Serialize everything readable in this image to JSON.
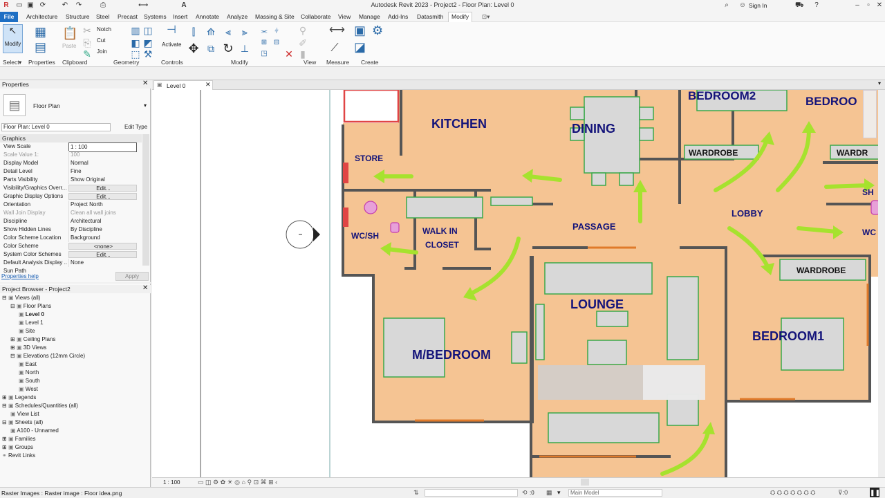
{
  "app": {
    "title": "Autodesk Revit 2023 - Project2 - Floor Plan: Level 0",
    "sign_in": "Sign In"
  },
  "menu": {
    "tabs": [
      "File",
      "Architecture",
      "Structure",
      "Steel",
      "Precast",
      "Systems",
      "Insert",
      "Annotate",
      "Analyze",
      "Massing & Site",
      "Collaborate",
      "View",
      "Manage",
      "Add-Ins",
      "Datasmith",
      "Modify"
    ],
    "active": "Modify"
  },
  "ribbon": {
    "panels": [
      "Select",
      "Properties",
      "Clipboard",
      "Geometry",
      "Controls",
      "Modify",
      "View",
      "Measure",
      "Create"
    ],
    "modify_label": "Modify",
    "paste_label": "Paste",
    "activate_label": "Activate",
    "notch": "Notch",
    "cut": "Cut",
    "join": "Join"
  },
  "properties": {
    "title": "Properties",
    "type_name": "Floor Plan",
    "instance_selector": "Floor Plan: Level 0",
    "edit_type": "Edit Type",
    "group": "Graphics",
    "rows": [
      {
        "k": "View Scale",
        "v": "1 : 100"
      },
      {
        "k": "Scale Value    1:",
        "v": "100"
      },
      {
        "k": "Display Model",
        "v": "Normal"
      },
      {
        "k": "Detail Level",
        "v": "Fine"
      },
      {
        "k": "Parts Visibility",
        "v": "Show Original"
      },
      {
        "k": "Visibility/Graphics Overr...",
        "v": "Edit..."
      },
      {
        "k": "Graphic Display Options",
        "v": "Edit..."
      },
      {
        "k": "Orientation",
        "v": "Project North"
      },
      {
        "k": "Wall Join Display",
        "v": "Clean all wall joins"
      },
      {
        "k": "Discipline",
        "v": "Architectural"
      },
      {
        "k": "Show Hidden Lines",
        "v": "By Discipline"
      },
      {
        "k": "Color Scheme Location",
        "v": "Background"
      },
      {
        "k": "Color Scheme",
        "v": "<none>"
      },
      {
        "k": "System Color Schemes",
        "v": "Edit..."
      },
      {
        "k": "Default Analysis Display ...",
        "v": "None"
      },
      {
        "k": "Sun Path",
        "v": ""
      }
    ],
    "help": "Properties help",
    "apply": "Apply"
  },
  "browser": {
    "title": "Project Browser - Project2",
    "items": [
      "Views (all)",
      "Floor Plans",
      "Level 0",
      "Level 1",
      "Site",
      "Ceiling Plans",
      "3D Views",
      "Elevations (12mm Circle)",
      "East",
      "North",
      "South",
      "West",
      "Legends",
      "Schedules/Quantities (all)",
      "View List",
      "Sheets (all)",
      "A100 - Unnamed",
      "Families",
      "Groups",
      "Revit Links"
    ]
  },
  "view": {
    "tab": "Level 0",
    "scale": "1 : 100"
  },
  "plan": {
    "rooms": [
      "KITCHEN",
      "DINING",
      "BEDROOM2",
      "BEDROO",
      "STORE",
      "WARDROBE",
      "WARDR",
      "LOBBY",
      "PASSAGE",
      "WALK IN",
      "CLOSET",
      "WC/SH",
      "SH",
      "WC",
      "LOUNGE",
      "M/BEDROOM",
      "WARDROBE",
      "BEDROOM1"
    ],
    "floor_color": "#f5c493",
    "wall_color": "#555555",
    "furniture_color": "#3aa84a",
    "arrow_color": "#a6e22e"
  },
  "status": {
    "text": "Raster Images : Raster image : Floor idea.png",
    "zero": ":0",
    "model": "Main Model"
  }
}
